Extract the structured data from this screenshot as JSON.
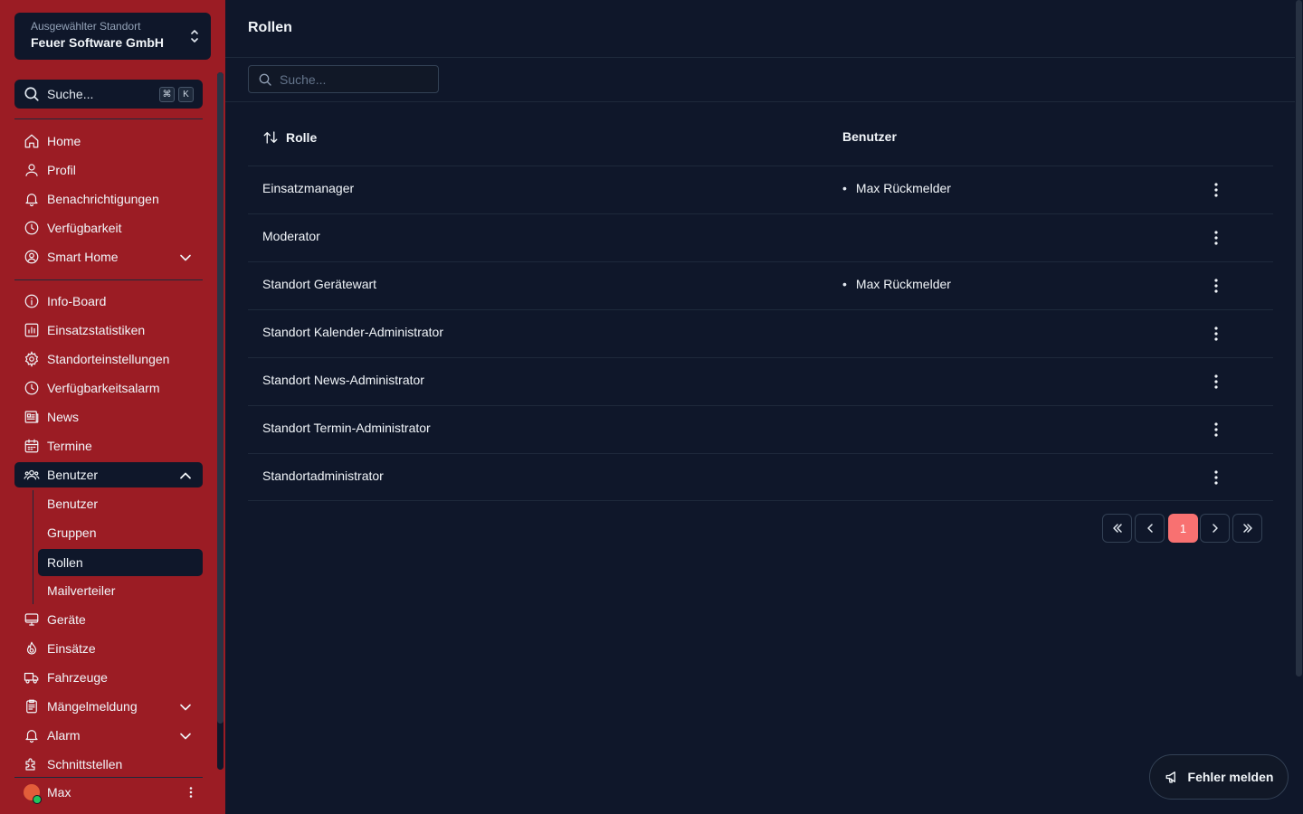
{
  "location": {
    "label": "Ausgewählter Standort",
    "name": "Feuer Software GmbH"
  },
  "search": {
    "label": "Suche...",
    "kbd1": "⌘",
    "kbd2": "K"
  },
  "nav": {
    "home": "Home",
    "profile": "Profil",
    "notifications": "Benachrichtigungen",
    "availability": "Verfügbarkeit",
    "smarthome": "Smart Home",
    "infoboard": "Info-Board",
    "stats": "Einsatzstatistiken",
    "settings": "Standorteinstellungen",
    "availalarm": "Verfügbarkeitsalarm",
    "news": "News",
    "events": "Termine",
    "users": "Benutzer",
    "sub_users": "Benutzer",
    "sub_groups": "Gruppen",
    "sub_roles": "Rollen",
    "sub_mail": "Mailverteiler",
    "devices": "Geräte",
    "operations": "Einsätze",
    "vehicles": "Fahrzeuge",
    "defects": "Mängelmeldung",
    "alarm": "Alarm",
    "interfaces": "Schnittstellen"
  },
  "user": {
    "name": "Max"
  },
  "page": {
    "title": "Rollen",
    "search_placeholder": "Suche..."
  },
  "table": {
    "col_role": "Rolle",
    "col_users": "Benutzer",
    "rows": [
      {
        "role": "Einsatzmanager",
        "user": "Max Rückmelder"
      },
      {
        "role": "Moderator",
        "user": ""
      },
      {
        "role": "Standort Gerätewart",
        "user": "Max Rückmelder"
      },
      {
        "role": "Standort Kalender-Administrator",
        "user": ""
      },
      {
        "role": "Standort News-Administrator",
        "user": ""
      },
      {
        "role": "Standort Termin-Administrator",
        "user": ""
      },
      {
        "role": "Standortadministrator",
        "user": ""
      }
    ]
  },
  "pagination": {
    "current": "1"
  },
  "report": {
    "label": "Fehler melden"
  },
  "colors": {
    "sidebar": "#9b1c24",
    "background": "#0f172a",
    "accent": "#f87171"
  }
}
